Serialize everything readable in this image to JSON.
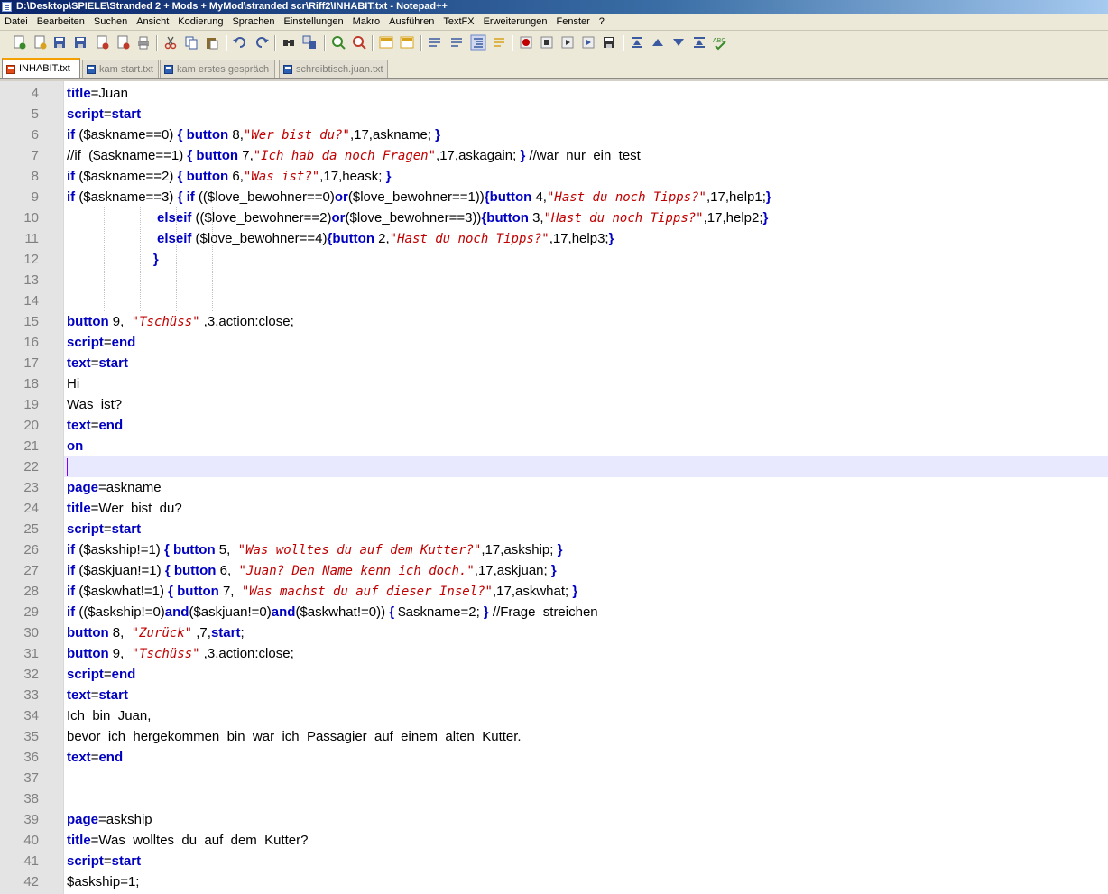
{
  "window": {
    "title": "D:\\Desktop\\SPIELE\\Stranded 2 + Mods  + MyMod\\stranded scr\\Riff2\\INHABIT.txt - Notepad++"
  },
  "menu": [
    "Datei",
    "Bearbeiten",
    "Suchen",
    "Ansicht",
    "Kodierung",
    "Sprachen",
    "Einstellungen",
    "Makro",
    "Ausführen",
    "TextFX",
    "Erweiterungen",
    "Fenster",
    "?"
  ],
  "toolbar": [
    {
      "icon": "new-file-icon",
      "color": "#3a8a2a"
    },
    {
      "icon": "open-file-icon",
      "color": "#d8a21c"
    },
    {
      "icon": "save-icon",
      "color": "#3c5aa0"
    },
    {
      "icon": "save-all-icon",
      "color": "#3c5aa0"
    },
    {
      "icon": "close-file-icon",
      "color": "#c03a2a"
    },
    {
      "icon": "close-all-icon",
      "color": "#c03a2a"
    },
    {
      "icon": "print-icon",
      "color": "#555555"
    },
    {
      "icon": "cut-icon",
      "color": "#c03a2a"
    },
    {
      "icon": "copy-icon",
      "color": "#3c5aa0"
    },
    {
      "icon": "paste-icon",
      "color": "#8a6a2a"
    },
    {
      "icon": "undo-icon",
      "color": "#3c5aa0"
    },
    {
      "icon": "redo-icon",
      "color": "#3c5aa0"
    },
    {
      "icon": "find-icon",
      "color": "#333333"
    },
    {
      "icon": "replace-icon",
      "color": "#3c5aa0"
    },
    {
      "icon": "zoom-in-icon",
      "color": "#3a8a2a"
    },
    {
      "icon": "zoom-out-icon",
      "color": "#c03a2a"
    },
    {
      "icon": "sync-vertical-icon",
      "color": "#d8a21c"
    },
    {
      "icon": "sync-horizontal-icon",
      "color": "#d8a21c"
    },
    {
      "icon": "word-wrap-icon",
      "color": "#3c5aa0"
    },
    {
      "icon": "show-all-chars-icon",
      "color": "#3c5aa0"
    },
    {
      "icon": "indent-guide-icon",
      "color": "#3c5aa0"
    },
    {
      "icon": "user-lang-icon",
      "color": "#d8a21c"
    },
    {
      "icon": "record-macro-icon",
      "color": "#c00000"
    },
    {
      "icon": "stop-macro-icon",
      "color": "#333333"
    },
    {
      "icon": "play-macro-icon",
      "color": "#333333"
    },
    {
      "icon": "run-macro-multiple-icon",
      "color": "#3c5aa0"
    },
    {
      "icon": "save-macro-icon",
      "color": "#333333"
    },
    {
      "icon": "fold-all-icon",
      "color": "#3c5aa0"
    },
    {
      "icon": "prev-icon",
      "color": "#3c5aa0"
    },
    {
      "icon": "next-icon",
      "color": "#3c5aa0"
    },
    {
      "icon": "unfold-all-icon",
      "color": "#3c5aa0"
    },
    {
      "icon": "spell-check-icon",
      "color": "#3a8a2a"
    }
  ],
  "tabs": [
    {
      "label": "INHABIT.txt",
      "active": true
    },
    {
      "label": "kam start.txt",
      "active": false
    },
    {
      "label": "kam erstes gespräch",
      "active": false
    },
    {
      "label": "schreibtisch.juan.txt",
      "active": false
    }
  ],
  "editor": {
    "current_line": 22,
    "lines": [
      {
        "n": "4",
        "t": [
          [
            "kw",
            "title"
          ],
          [
            "",
            "=Juan"
          ]
        ]
      },
      {
        "n": "5",
        "t": [
          [
            "kw",
            "script"
          ],
          [
            "",
            "="
          ],
          [
            "kw",
            "start"
          ]
        ]
      },
      {
        "n": "6",
        "t": [
          [
            "kw",
            "if"
          ],
          [
            "",
            " ($askname==0) "
          ],
          [
            "kw",
            "{ button"
          ],
          [
            "",
            " 8,"
          ],
          [
            "str",
            "\"Wer bist du?\""
          ],
          [
            "",
            ",17,askname; "
          ],
          [
            "kw",
            "}"
          ]
        ]
      },
      {
        "n": "7",
        "t": [
          [
            "",
            "//if  ($askname==1) "
          ],
          [
            "kw",
            "{ button"
          ],
          [
            "",
            " 7,"
          ],
          [
            "str",
            "\"Ich hab da noch Fragen\""
          ],
          [
            "",
            ",17,askagain; "
          ],
          [
            "kw",
            "}"
          ],
          [
            "",
            " //war  nur  ein  test"
          ]
        ]
      },
      {
        "n": "8",
        "t": [
          [
            "kw",
            "if"
          ],
          [
            "",
            " ($askname==2) "
          ],
          [
            "kw",
            "{ button"
          ],
          [
            "",
            " 6,"
          ],
          [
            "str",
            "\"Was ist?\""
          ],
          [
            "",
            ",17,heask; "
          ],
          [
            "kw",
            "}"
          ]
        ]
      },
      {
        "n": "9",
        "t": [
          [
            "kw",
            "if"
          ],
          [
            "",
            " ($askname==3) "
          ],
          [
            "kw",
            "{ if"
          ],
          [
            "",
            " (($love_bewohner==0)"
          ],
          [
            "kw",
            "or"
          ],
          [
            "",
            "($love_bewohner==1))"
          ],
          [
            "kw",
            "{button"
          ],
          [
            "",
            " 4,"
          ],
          [
            "str",
            "\"Hast du noch Tipps?\""
          ],
          [
            "",
            ",17,help1;"
          ],
          [
            "kw",
            "}"
          ]
        ]
      },
      {
        "n": "10",
        "t": [
          [
            "",
            "                        "
          ],
          [
            "kw",
            "elseif"
          ],
          [
            "",
            " (($love_bewohner==2)"
          ],
          [
            "kw",
            "or"
          ],
          [
            "",
            "($love_bewohner==3))"
          ],
          [
            "kw",
            "{button"
          ],
          [
            "",
            " 3,"
          ],
          [
            "str",
            "\"Hast du noch Tipps?\""
          ],
          [
            "",
            ",17,help2;"
          ],
          [
            "kw",
            "}"
          ]
        ]
      },
      {
        "n": "11",
        "t": [
          [
            "",
            "                        "
          ],
          [
            "kw",
            "elseif"
          ],
          [
            "",
            " ($love_bewohner==4)"
          ],
          [
            "kw",
            "{button"
          ],
          [
            "",
            " 2,"
          ],
          [
            "str",
            "\"Hast du noch Tipps?\""
          ],
          [
            "",
            ",17,help3;"
          ],
          [
            "kw",
            "}"
          ]
        ]
      },
      {
        "n": "12",
        "t": [
          [
            "",
            "                       "
          ],
          [
            "kw",
            "}"
          ]
        ]
      },
      {
        "n": "13",
        "t": []
      },
      {
        "n": "14",
        "t": []
      },
      {
        "n": "15",
        "t": [
          [
            "kw",
            "button"
          ],
          [
            "",
            " 9,  "
          ],
          [
            "str",
            "\"Tschüss\""
          ],
          [
            "",
            " ,3,action:close;"
          ]
        ]
      },
      {
        "n": "16",
        "t": [
          [
            "kw",
            "script"
          ],
          [
            "",
            "="
          ],
          [
            "kw",
            "end"
          ]
        ]
      },
      {
        "n": "17",
        "t": [
          [
            "kw",
            "text"
          ],
          [
            "",
            "="
          ],
          [
            "kw",
            "start"
          ]
        ]
      },
      {
        "n": "18",
        "t": [
          [
            "",
            "Hi"
          ]
        ]
      },
      {
        "n": "19",
        "t": [
          [
            "",
            "Was  ist?"
          ]
        ]
      },
      {
        "n": "20",
        "t": [
          [
            "kw",
            "text"
          ],
          [
            "",
            "="
          ],
          [
            "kw",
            "end"
          ]
        ]
      },
      {
        "n": "21",
        "t": [
          [
            "kw",
            "on"
          ]
        ]
      },
      {
        "n": "22",
        "t": []
      },
      {
        "n": "23",
        "t": [
          [
            "kw",
            "page"
          ],
          [
            "",
            "=askname"
          ]
        ]
      },
      {
        "n": "24",
        "t": [
          [
            "kw",
            "title"
          ],
          [
            "",
            "=Wer  bist  du?"
          ]
        ]
      },
      {
        "n": "25",
        "t": [
          [
            "kw",
            "script"
          ],
          [
            "",
            "="
          ],
          [
            "kw",
            "start"
          ]
        ]
      },
      {
        "n": "26",
        "t": [
          [
            "kw",
            "if"
          ],
          [
            "",
            " ($askship!=1) "
          ],
          [
            "kw",
            "{ button"
          ],
          [
            "",
            " 5,  "
          ],
          [
            "str",
            "\"Was wolltes du auf dem Kutter?\""
          ],
          [
            "",
            ",17,askship; "
          ],
          [
            "kw",
            "}"
          ]
        ]
      },
      {
        "n": "27",
        "t": [
          [
            "kw",
            "if"
          ],
          [
            "",
            " ($askjuan!=1) "
          ],
          [
            "kw",
            "{ button"
          ],
          [
            "",
            " 6,  "
          ],
          [
            "str",
            "\"Juan? Den Name kenn ich doch.\""
          ],
          [
            "",
            ",17,askjuan; "
          ],
          [
            "kw",
            "}"
          ]
        ]
      },
      {
        "n": "28",
        "t": [
          [
            "kw",
            "if"
          ],
          [
            "",
            " ($askwhat!=1) "
          ],
          [
            "kw",
            "{ button"
          ],
          [
            "",
            " 7,  "
          ],
          [
            "str",
            "\"Was machst du auf dieser Insel?\""
          ],
          [
            "",
            ",17,askwhat; "
          ],
          [
            "kw",
            "}"
          ]
        ]
      },
      {
        "n": "29",
        "t": [
          [
            "kw",
            "if"
          ],
          [
            "",
            " (($askship!=0)"
          ],
          [
            "kw",
            "and"
          ],
          [
            "",
            "($askjuan!=0)"
          ],
          [
            "kw",
            "and"
          ],
          [
            "",
            "($askwhat!=0)) "
          ],
          [
            "kw",
            "{"
          ],
          [
            "",
            " $askname=2; "
          ],
          [
            "kw",
            "}"
          ],
          [
            "",
            " //Frage  streichen"
          ]
        ]
      },
      {
        "n": "30",
        "t": [
          [
            "kw",
            "button"
          ],
          [
            "",
            " 8,  "
          ],
          [
            "str",
            "\"Zurück\""
          ],
          [
            "",
            " ,7,"
          ],
          [
            "kw",
            "start"
          ],
          [
            "",
            ";"
          ]
        ]
      },
      {
        "n": "31",
        "t": [
          [
            "kw",
            "button"
          ],
          [
            "",
            " 9,  "
          ],
          [
            "str",
            "\"Tschüss\""
          ],
          [
            "",
            " ,3,action:close;"
          ]
        ]
      },
      {
        "n": "32",
        "t": [
          [
            "kw",
            "script"
          ],
          [
            "",
            "="
          ],
          [
            "kw",
            "end"
          ]
        ]
      },
      {
        "n": "33",
        "t": [
          [
            "kw",
            "text"
          ],
          [
            "",
            "="
          ],
          [
            "kw",
            "start"
          ]
        ]
      },
      {
        "n": "34",
        "t": [
          [
            "",
            "Ich  bin  Juan,"
          ]
        ]
      },
      {
        "n": "35",
        "t": [
          [
            "",
            "bevor  ich  hergekommen  bin  war  ich  Passagier  auf  einem  alten  Kutter."
          ]
        ]
      },
      {
        "n": "36",
        "t": [
          [
            "kw",
            "text"
          ],
          [
            "",
            "="
          ],
          [
            "kw",
            "end"
          ]
        ]
      },
      {
        "n": "37",
        "t": []
      },
      {
        "n": "38",
        "t": []
      },
      {
        "n": "39",
        "t": [
          [
            "kw",
            "page"
          ],
          [
            "",
            "=askship"
          ]
        ]
      },
      {
        "n": "40",
        "t": [
          [
            "kw",
            "title"
          ],
          [
            "",
            "=Was  wolltes  du  auf  dem  Kutter?"
          ]
        ]
      },
      {
        "n": "41",
        "t": [
          [
            "kw",
            "script"
          ],
          [
            "",
            "="
          ],
          [
            "kw",
            "start"
          ]
        ]
      },
      {
        "n": "42",
        "t": [
          [
            "",
            "$askship=1;"
          ]
        ]
      }
    ]
  }
}
